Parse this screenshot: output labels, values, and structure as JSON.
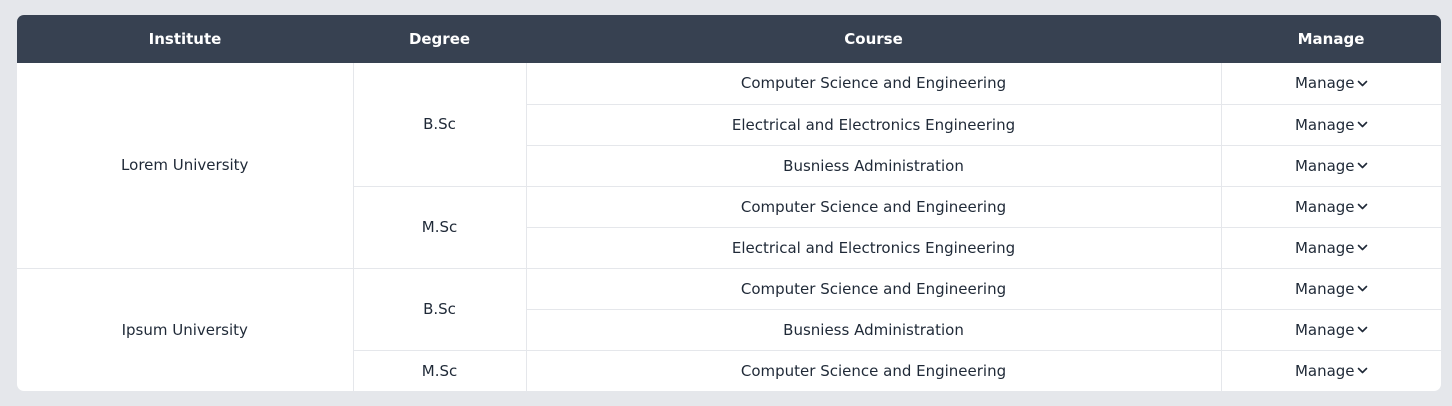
{
  "table": {
    "headers": [
      "Institute",
      "Degree",
      "Course",
      "Manage"
    ],
    "institutes": [
      {
        "name": "Lorem University",
        "degrees": [
          {
            "name": "B.Sc",
            "courses": [
              "Computer Science and Engineering",
              "Electrical and Electronics Engineering",
              "Busniess Administration"
            ]
          },
          {
            "name": "M.Sc",
            "courses": [
              "Computer Science and Engineering",
              "Electrical and Electronics Engineering"
            ]
          }
        ]
      },
      {
        "name": "Ipsum University",
        "degrees": [
          {
            "name": "B.Sc",
            "courses": [
              "Computer Science and Engineering",
              "Busniess Administration"
            ]
          },
          {
            "name": "M.Sc",
            "courses": [
              "Computer Science and Engineering"
            ]
          }
        ]
      }
    ],
    "manage_label": "Manage",
    "manage_icon": "chevron-down-icon"
  },
  "colors": {
    "header_bg": "#374151",
    "page_bg": "#e5e7eb",
    "border": "#e5e7eb"
  }
}
